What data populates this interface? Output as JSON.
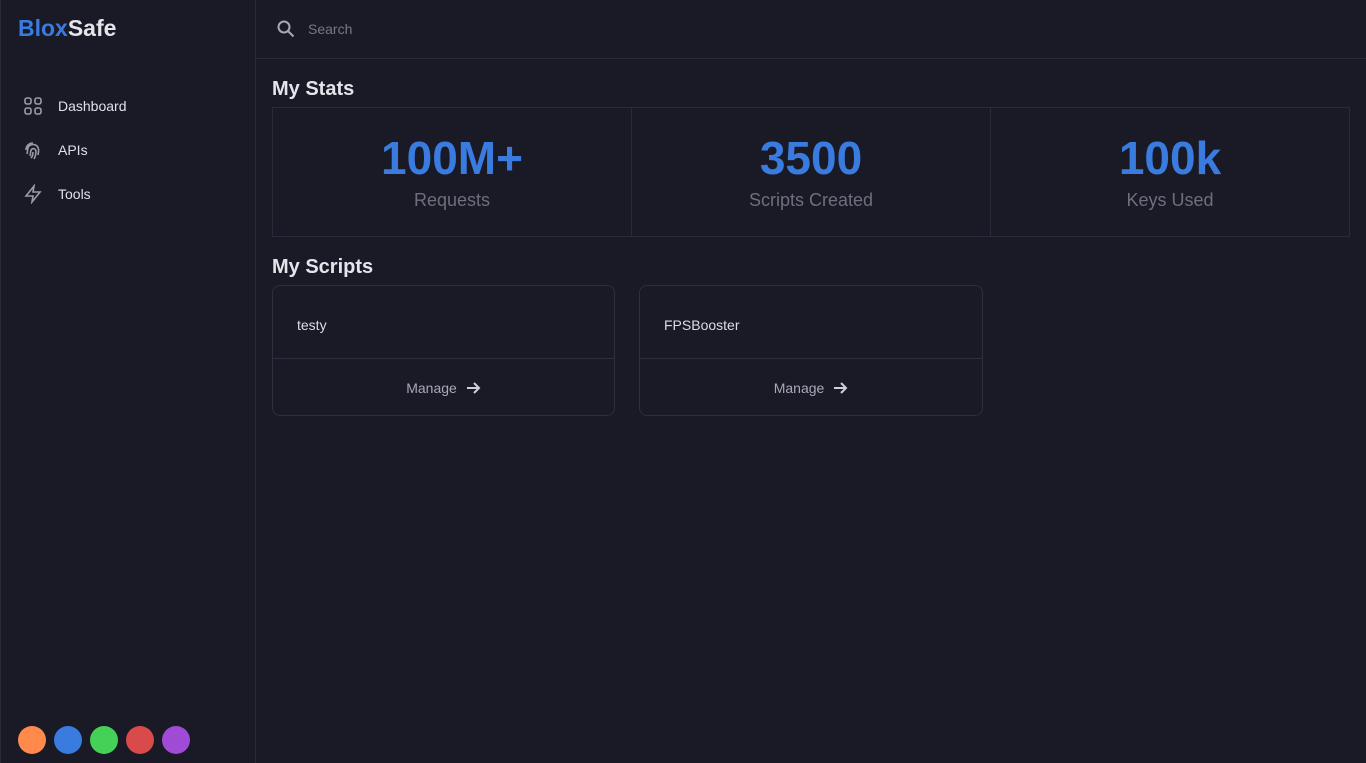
{
  "brand": {
    "part1": "Blox",
    "part2": "Safe"
  },
  "sidebar": {
    "items": [
      {
        "label": "Dashboard",
        "icon": "grid-icon"
      },
      {
        "label": "APIs",
        "icon": "fingerprint-icon"
      },
      {
        "label": "Tools",
        "icon": "bolt-icon"
      }
    ]
  },
  "themes": [
    "#ff8a4c",
    "#3a7be0",
    "#45d058",
    "#d94a4a",
    "#a04bd6"
  ],
  "search": {
    "placeholder": "Search"
  },
  "stats": {
    "title": "My Stats",
    "items": [
      {
        "value": "100M+",
        "label": "Requests"
      },
      {
        "value": "3500",
        "label": "Scripts Created"
      },
      {
        "value": "100k",
        "label": "Keys Used"
      }
    ]
  },
  "scripts": {
    "title": "My Scripts",
    "items": [
      {
        "name": "testy",
        "action": "Manage"
      },
      {
        "name": "FPSBooster",
        "action": "Manage"
      }
    ]
  }
}
